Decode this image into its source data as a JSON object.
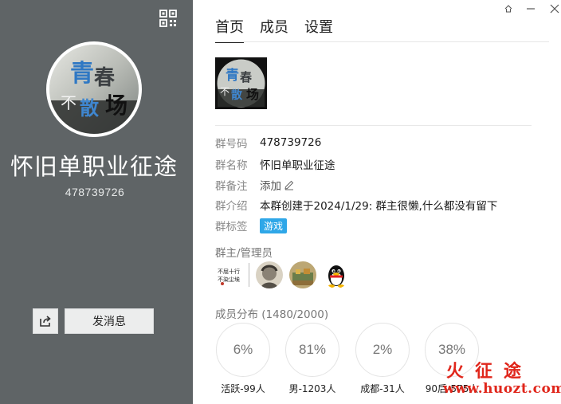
{
  "left_panel": {
    "group_name": "怀旧单职业征途",
    "group_id": "478739726",
    "send_message_label": "发消息",
    "avatar_text": "青春不散场"
  },
  "tabs": [
    "首页",
    "成员",
    "设置"
  ],
  "info": {
    "group_code_label": "群号码",
    "group_code": "478739726",
    "group_name_label": "群名称",
    "group_name": "怀旧单职业征途",
    "remark_label": "群备注",
    "remark_value": "添加",
    "intro_label": "群介绍",
    "intro_value": "本群创建于2024/1/29:  群主很懒,什么都没有留下",
    "tags_label": "群标签",
    "tag": "游戏"
  },
  "admins_title": "群主/管理员",
  "admin_avatar_text": "不屈十行\n不染尘埃",
  "distribution": {
    "title": "成员分布 (1480/2000)",
    "items": [
      {
        "percent": "6%",
        "label": "活跃-99人"
      },
      {
        "percent": "81%",
        "label": "男-1203人"
      },
      {
        "percent": "2%",
        "label": "成都-31人"
      },
      {
        "percent": "38%",
        "label": "90后-575人"
      }
    ]
  },
  "watermark": {
    "line1": "火征途",
    "line2": "www.huozt.com"
  },
  "colors": {
    "left_bg": "#5f6466",
    "tag_bg": "#2fa7e8",
    "watermark": "#e0261b"
  }
}
